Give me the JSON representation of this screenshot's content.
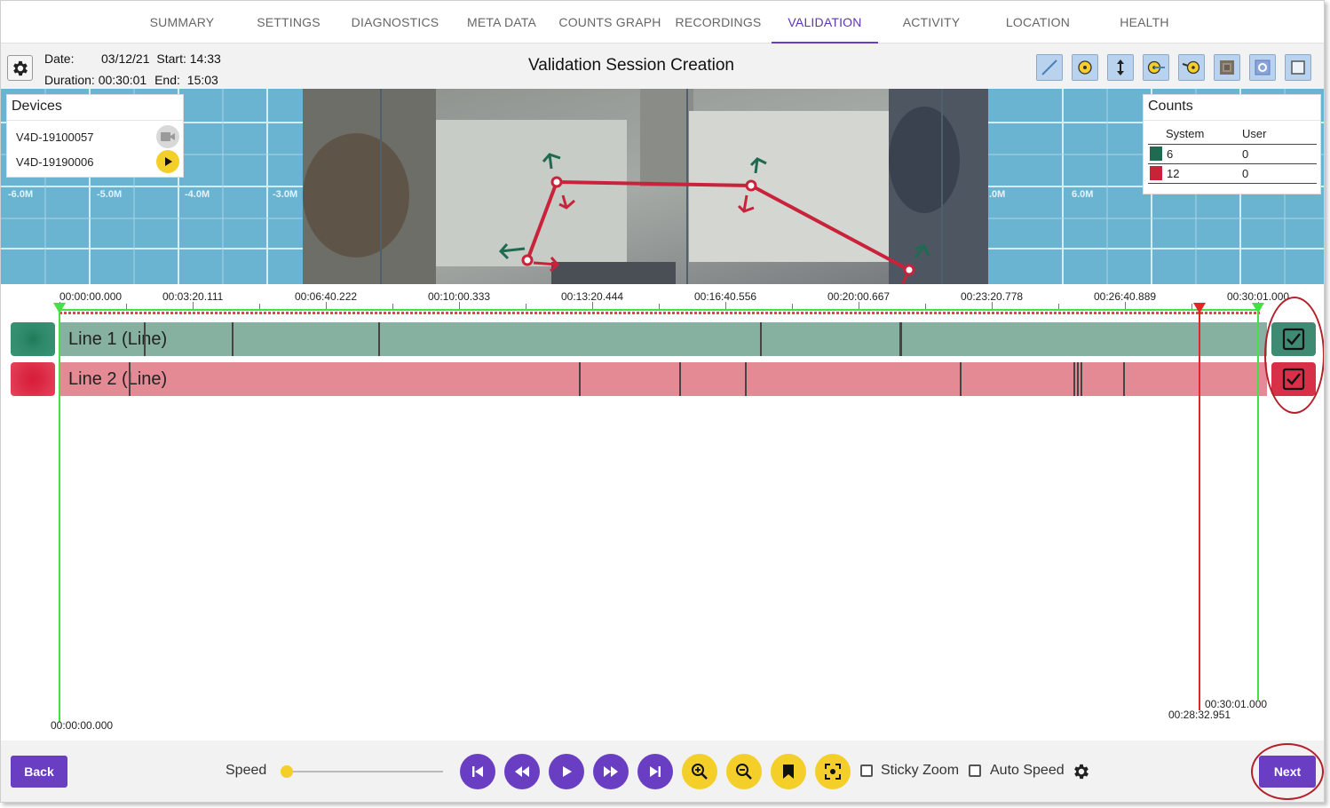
{
  "tabs": [
    {
      "label": "SUMMARY",
      "active": false
    },
    {
      "label": "SETTINGS",
      "active": false
    },
    {
      "label": "DIAGNOSTICS",
      "active": false
    },
    {
      "label": "META DATA",
      "active": false
    },
    {
      "label": "COUNTS GRAPH",
      "active": false
    },
    {
      "label": "RECORDINGS",
      "active": false
    },
    {
      "label": "VALIDATION",
      "active": true
    },
    {
      "label": "ACTIVITY",
      "active": false
    },
    {
      "label": "LOCATION",
      "active": false
    },
    {
      "label": "HEALTH",
      "active": false
    }
  ],
  "session": {
    "date_label": "Date:",
    "date": "03/12/21",
    "start_label": "Start:",
    "start": "14:33",
    "duration_label": "Duration:",
    "duration": "00:30:01",
    "end_label": "End:",
    "end": "15:03"
  },
  "page_title": "Validation Session Creation",
  "toolbar_icons": [
    "line-tool-icon",
    "point-zone-icon",
    "vertical-arrow-icon",
    "point-line-icon",
    "line-point-icon",
    "mask-icon",
    "settings-zone-icon",
    "square-icon"
  ],
  "video": {
    "scale_left": [
      "-6.0M",
      "-5.0M",
      "-4.0M",
      "-3.0M"
    ],
    "scale_right": [
      ".0M",
      "6.0M"
    ]
  },
  "devices": {
    "title": "Devices",
    "items": [
      {
        "name": "V4D-19100057",
        "icon": "video-camera-icon"
      },
      {
        "name": "V4D-19190006",
        "icon": "play-icon"
      }
    ]
  },
  "counts": {
    "title": "Counts",
    "col_system": "System",
    "col_user": "User",
    "rows": [
      {
        "color": "#1e6b52",
        "system": "6",
        "user": "0"
      },
      {
        "color": "#c92339",
        "system": "12",
        "user": "0"
      }
    ]
  },
  "timeline": {
    "ticks": [
      "00:00:00.000",
      "00:03:20.111",
      "00:06:40.222",
      "00:10:00.333",
      "00:13:20.444",
      "00:16:40.556",
      "00:20:00.667",
      "00:23:20.778",
      "00:26:40.889",
      "00:30:01.000"
    ],
    "start_cursor": "00:00:00.000",
    "play_cursor": "00:28:32.951",
    "end_cursor": "00:30:01.000",
    "tracks": [
      {
        "name": "Line 1 (Line)",
        "color": "#86b0a0",
        "swatch": "#2e8a6a",
        "check_bg": "#3f8a72",
        "check": "true"
      },
      {
        "name": "Line 2 (Line)",
        "color": "#e48a95",
        "swatch": "#dc2a44",
        "check_bg": "#d9304a",
        "check": "true"
      }
    ]
  },
  "footer": {
    "back": "Back",
    "next": "Next",
    "speed_label": "Speed",
    "speed_value": 0,
    "sticky_zoom": "Sticky Zoom",
    "auto_speed": "Auto Speed",
    "sticky_zoom_checked": false,
    "auto_speed_checked": false
  },
  "colors": {
    "accent": "#6a3ec2",
    "yellow": "#f4cf2a",
    "green_line": "#44e044",
    "red_line": "#e02828"
  }
}
